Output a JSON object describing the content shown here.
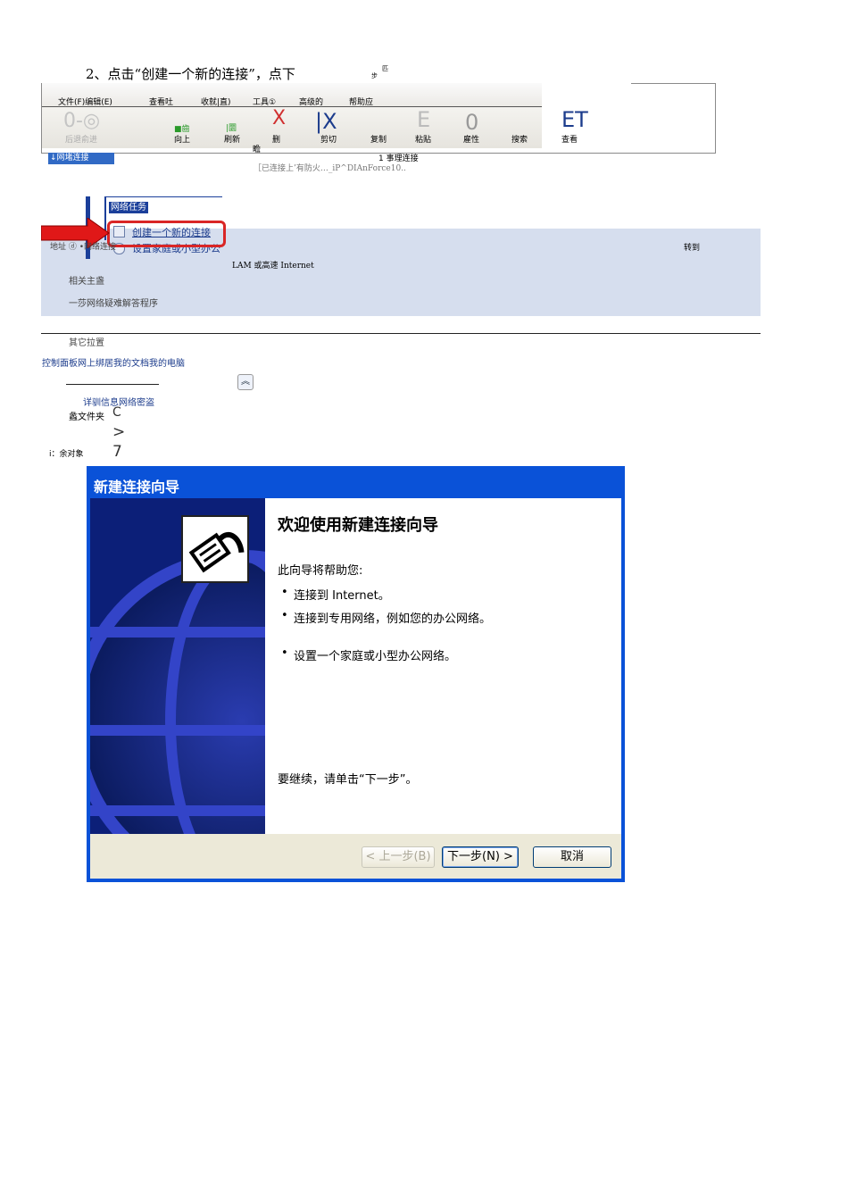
{
  "step": {
    "title": "2、点击“创建一个新的连接”，点下",
    "sup1": "步",
    "sup2": "匹"
  },
  "explorer": {
    "menu": [
      "文件(F)编辑(E)",
      "查看吐",
      "收就|直)",
      "工具①",
      "高级的",
      "帮助应"
    ],
    "toolbar_glyphs": [
      "0-◎",
      "■齒",
      "|圜",
      "X",
      "|X",
      "E",
      "0",
      "ET"
    ],
    "toolbar_labels": [
      "后退俞进",
      "向上",
      "刷新",
      "删",
      "剪切",
      "复制",
      "粘贴",
      "雇性",
      "搜索",
      "查看"
    ],
    "extra_label": "瞻",
    "address": "↓网堵连接",
    "status_line1": "1 事理连接",
    "status_line2": "［已连接上’有防火…_iP^DIAnForce10.."
  },
  "taskpane": {
    "header": "网络任务",
    "item1": "创建一个新的连接",
    "item2": "设置家庭或小型办公",
    "address_prefix": "地址 ⓓ •网络连接",
    "goto": "转到",
    "lan": "LAM 或高速 Internet",
    "related": "相关主盏",
    "troubleshoot": "一莎网络疑难解答程序",
    "other": "其它拉置",
    "other_links": "控制面板网上绑居我的文档我的电脑",
    "details": "详驯信息网络密盗",
    "folder": "蠡文件夹",
    "objects": "i：余对象",
    "side_c": "C",
    "side_gt": ">",
    "side_7": "7"
  },
  "wizard": {
    "title": "新建连接向导",
    "heading": "欢迎使用新建连接向导",
    "intro": "此向导将帮助您:",
    "bullets": [
      "连接到 Internet。",
      "连接到专用网络，例如您的办公网络。",
      "设置一个家庭或小型办公网络。"
    ],
    "continue": "要继续，请单击“下一步”。",
    "back_button": "< 上一步(B)",
    "next_button": "下一步(N) >",
    "cancel_button": "取消"
  }
}
